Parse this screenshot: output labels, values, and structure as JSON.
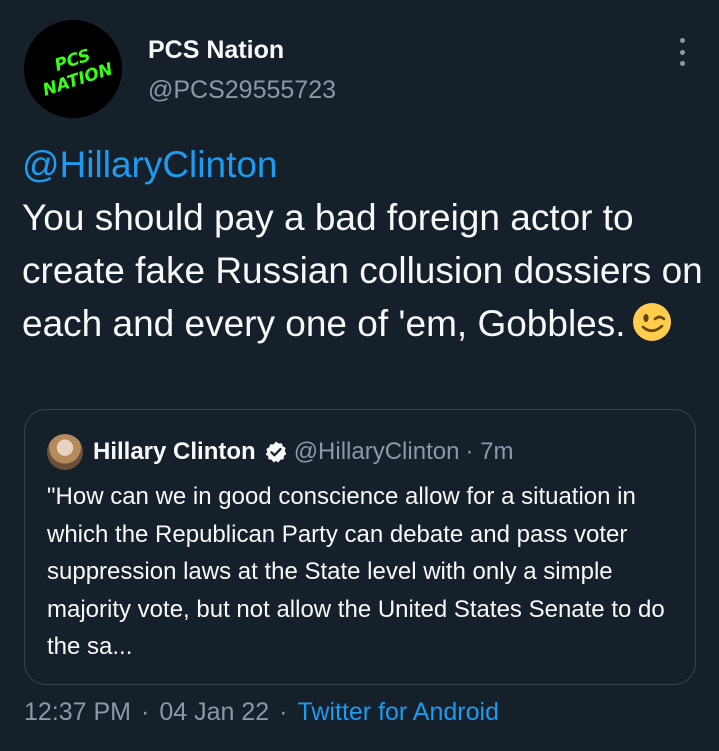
{
  "author": {
    "name": "PCS Nation",
    "handle": "@PCS29555723",
    "avatar_text": "PCS NATION",
    "avatar_text_color": "#39ff14"
  },
  "tweet": {
    "mention": "@HillaryClinton",
    "text": "You should pay a bad foreign actor to create fake Russian collusion dossiers on each and every one of 'em, Gobbles.",
    "emoji": "winking-face"
  },
  "quoted": {
    "name": "Hillary Clinton",
    "verified": true,
    "handle": "@HillaryClinton",
    "time": "· 7m",
    "text": "\"How can we in good conscience allow for a situation in which the Republican Party can debate and pass voter suppression laws at the State level with only a simple majority vote, but not allow the United States Senate to do the sa..."
  },
  "meta": {
    "time": "12:37 PM",
    "date": "04 Jan 22",
    "separator": "·",
    "source": "Twitter for Android"
  },
  "colors": {
    "background": "#15202b",
    "accent": "#1d9bf0",
    "secondary_text": "#8b98a5",
    "border": "#38444d"
  }
}
